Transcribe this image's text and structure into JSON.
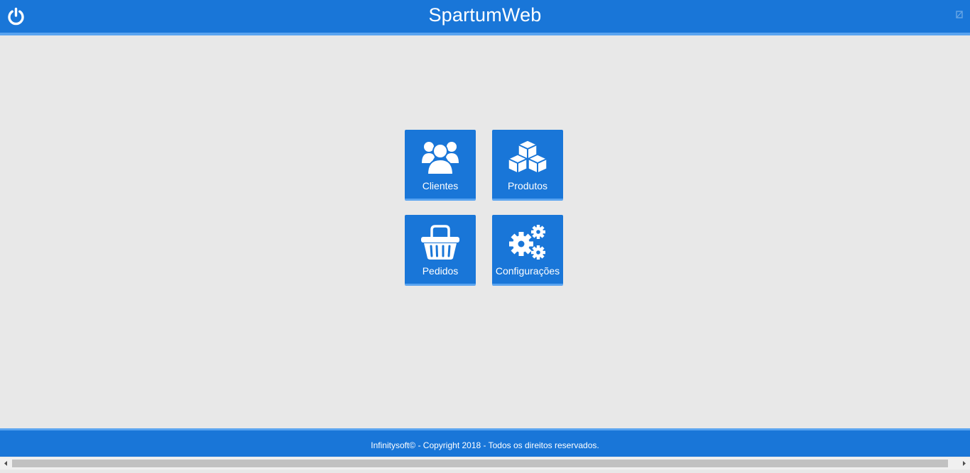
{
  "header": {
    "title": "SpartumWeb",
    "power_icon": "power-icon"
  },
  "tiles": [
    {
      "label": "Clientes",
      "icon": "users-icon"
    },
    {
      "label": "Produtos",
      "icon": "cubes-icon"
    },
    {
      "label": "Pedidos",
      "icon": "basket-icon"
    },
    {
      "label": "Configurações",
      "icon": "gears-icon"
    }
  ],
  "footer": {
    "text": "Infinitysoft© - Copyright 2018 - Todos os direitos reservados."
  },
  "colors": {
    "primary": "#1976d8",
    "accent": "#5aa4f0",
    "background": "#e8e8e8",
    "text": "#ffffff"
  }
}
